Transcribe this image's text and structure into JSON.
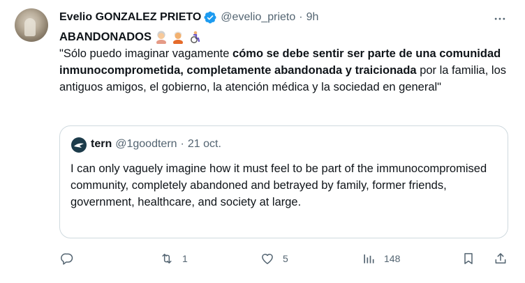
{
  "author": {
    "display_name": "Evelio GONZALEZ PRIETO",
    "handle": "@evelio_prieto",
    "separator": "·",
    "time": "9h"
  },
  "post": {
    "title": "ABANDONADOS",
    "title_emojis": [
      "older-woman-emoji",
      "older-man-emoji",
      "person-in-wheelchair-emoji"
    ],
    "body_parts": [
      {
        "text": "\"Sólo puedo imaginar vagamente ",
        "bold": false
      },
      {
        "text": "cómo se debe sentir ser parte de una comunidad inmunocomprometida, completamente abandonada y traicionada",
        "bold": true
      },
      {
        "text": " por la familia, los antiguos amigos, el gobierno, la atención médica y la sociedad en general\"",
        "bold": false
      }
    ]
  },
  "quote": {
    "display_name": "tern",
    "handle": "@1goodtern",
    "separator": "·",
    "time": "21 oct.",
    "text": "I can only vaguely imagine how it must feel to be part of the immunocompromised community, completely abandoned and betrayed by family, former friends, government, healthcare, and society at large."
  },
  "actions": {
    "reply_count": "",
    "repost_count": "1",
    "like_count": "5",
    "views_count": "148"
  },
  "colors": {
    "text": "#0f1419",
    "secondary": "#536471",
    "verified": "#1d9bf0",
    "border": "#cfd9de"
  }
}
